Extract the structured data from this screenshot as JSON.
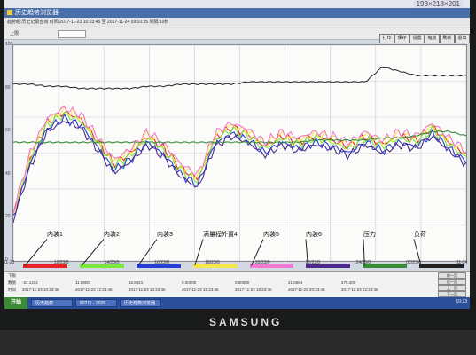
{
  "window": {
    "title": "历史趋势浏览器",
    "coords": "198×218×201",
    "info_text": "趋势组:历史记录查询 时间:2017-11-23 10:23:45 至 2017-11-24 09:10:35 间隔:10秒",
    "row_label": "上限",
    "toolbar_buttons": [
      "打印",
      "保存",
      "设置",
      "缩放",
      "刷新",
      "退出"
    ]
  },
  "chart_data": {
    "type": "line",
    "title": "",
    "xlabel": "",
    "ylabel": "",
    "x_ticks": [
      "11-23",
      "12/23/0",
      "14/23/0",
      "16/23/0",
      "18/23/0",
      "20/23/0",
      "22/23/0",
      "24/23/0",
      "02/23/0",
      "11-24"
    ],
    "y_ticks": [
      "100",
      "80",
      "60",
      "40",
      "20",
      "0"
    ],
    "ylim": [
      0,
      100
    ],
    "grid": true,
    "series": [
      {
        "name": "内装1",
        "color": "#e8242a",
        "values": [
          22,
          48,
          64,
          69,
          66,
          56,
          45,
          50,
          58,
          52,
          43,
          38,
          57,
          62,
          59,
          53,
          58,
          55,
          58,
          56,
          53,
          58,
          54,
          58,
          56,
          62,
          55,
          49
        ]
      },
      {
        "name": "内装2",
        "color": "#7de83c",
        "values": [
          21,
          47,
          63,
          68,
          65,
          55,
          44,
          49,
          57,
          51,
          42,
          37,
          56,
          61,
          58,
          52,
          57,
          54,
          57,
          55,
          52,
          57,
          53,
          57,
          55,
          61,
          54,
          48
        ]
      },
      {
        "name": "内装3",
        "color": "#2a3dd4",
        "values": [
          20,
          45,
          61,
          66,
          63,
          53,
          42,
          47,
          55,
          49,
          40,
          35,
          54,
          59,
          56,
          50,
          55,
          52,
          55,
          53,
          50,
          55,
          51,
          55,
          53,
          59,
          52,
          46
        ]
      },
      {
        "name": "满量程外置4",
        "color": "#f4e84a",
        "values": [
          22,
          49,
          65,
          70,
          67,
          57,
          46,
          51,
          59,
          53,
          44,
          39,
          58,
          63,
          60,
          54,
          59,
          56,
          59,
          57,
          54,
          59,
          55,
          59,
          57,
          63,
          56,
          50
        ]
      },
      {
        "name": "内装5",
        "color": "#f07ad0",
        "values": [
          23,
          50,
          66,
          71,
          68,
          58,
          47,
          52,
          60,
          54,
          45,
          40,
          59,
          64,
          61,
          55,
          60,
          57,
          60,
          58,
          55,
          60,
          56,
          60,
          58,
          64,
          57,
          51
        ]
      },
      {
        "name": "内装6",
        "color": "#4c2a8c",
        "values": [
          19,
          44,
          60,
          65,
          62,
          52,
          41,
          46,
          54,
          48,
          39,
          34,
          53,
          58,
          55,
          49,
          54,
          51,
          54,
          52,
          49,
          54,
          50,
          54,
          52,
          58,
          51,
          45
        ]
      },
      {
        "name": "压力",
        "color": "#3a8a3a",
        "values": [
          55,
          55,
          55,
          55,
          55,
          55,
          55,
          55,
          55,
          55,
          55,
          55,
          55,
          55,
          55,
          55,
          55,
          55,
          56,
          56,
          56,
          56,
          57,
          57,
          58,
          60,
          60,
          58
        ]
      },
      {
        "name": "负荷",
        "color": "#222222",
        "values": [
          82,
          82,
          81,
          81,
          80,
          80,
          80,
          80,
          81,
          81,
          82,
          82,
          82,
          82,
          83,
          83,
          83,
          83,
          83,
          83,
          83,
          83,
          90,
          88,
          86,
          86,
          86,
          86
        ]
      }
    ]
  },
  "legend_callouts": [
    "内装1",
    "内装2",
    "内装3",
    "满量程外置4",
    "内装5",
    "内装6",
    "压力",
    "负荷"
  ],
  "table": {
    "rows": [
      [
        "下限",
        "",
        "",
        "",
        "",
        "",
        "",
        ""
      ],
      [
        "数值",
        "-22.1422",
        "11.9800",
        "15.8821",
        "0.00000",
        "0.00000",
        "21.5564",
        "475.400"
      ],
      [
        "时间",
        "2017-11-23 10:23:45",
        "2017-11-23 12:23:45",
        "2017-11-23 14:23:45",
        "2017-11-23 16:23:45",
        "2017-11-23 18:23:45",
        "2017-11-23 20:23:45",
        "2017-11-23 22:23:45"
      ]
    ],
    "right_buttons": [
      "前一页",
      "后一页",
      "上一页",
      "下一页"
    ]
  },
  "taskbar": {
    "start": "开始",
    "tasks": [
      "历史趋势...",
      "80211 - 2026...",
      "历史趋势浏览器"
    ],
    "clock": "10:23"
  },
  "monitor": {
    "brand": "SAMSUNG"
  }
}
